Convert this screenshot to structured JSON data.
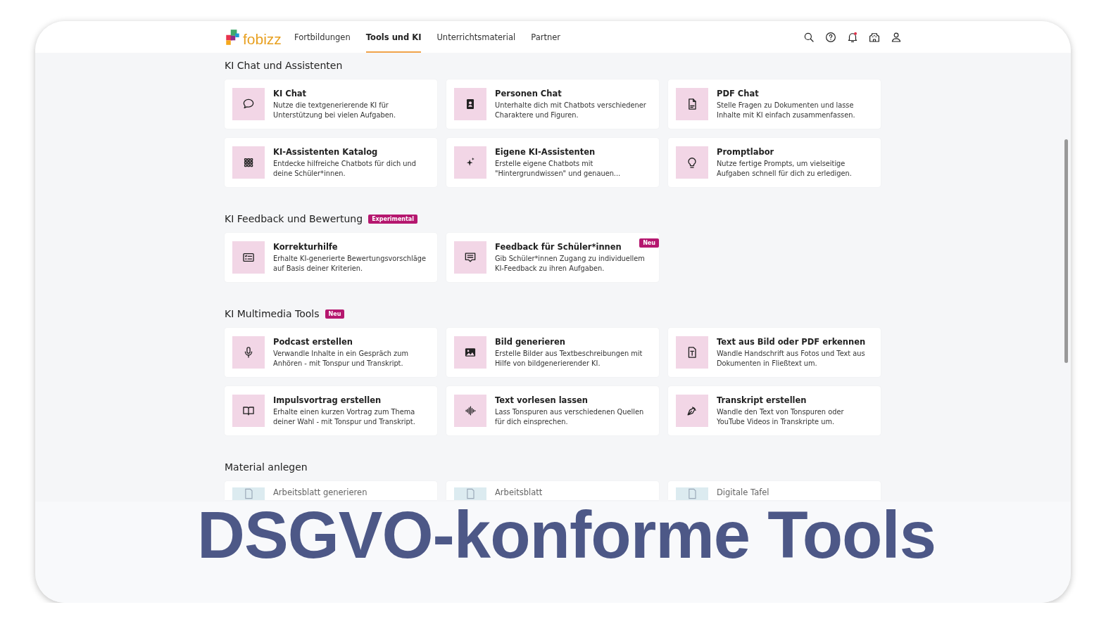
{
  "nav": {
    "logo": "fobizz",
    "items": [
      {
        "label": "Fortbildungen",
        "selected": false
      },
      {
        "label": "Tools und KI",
        "selected": true
      },
      {
        "label": "Unterrichtsmaterial",
        "selected": false
      },
      {
        "label": "Partner",
        "selected": false
      }
    ],
    "notifications_unread": true
  },
  "sections": [
    {
      "title": "KI Chat und Assistenten",
      "cards": [
        {
          "kind": "chat",
          "title": "KI Chat",
          "description": "Nutze die textgenerierende KI für Unterstützung bei vielen Aufgaben."
        },
        {
          "kind": "person",
          "title": "Personen Chat",
          "description": "Unterhalte dich mit Chatbots verschiedener Charaktere und Figuren."
        },
        {
          "kind": "pdf",
          "title": "PDF Chat",
          "description": "Stelle Fragen zu Dokumenten und lasse Inhalte mit KI einfach zusammenfassen."
        },
        {
          "kind": "grid",
          "title": "KI-Assistenten Katalog",
          "description": "Entdecke hilfreiche Chatbots für dich und deine Schüler*innen."
        },
        {
          "kind": "sparkle",
          "title": "Eigene KI-Assistenten",
          "description": "Erstelle eigene Chatbots mit \"Hintergrundwissen\" und genauen..."
        },
        {
          "kind": "bulb",
          "title": "Promptlabor",
          "description": "Nutze fertige Prompts, um vielseitige Aufgaben schnell für dich zu erledigen."
        }
      ]
    },
    {
      "title": "KI Feedback und Bewertung",
      "badge": "Experimental",
      "cards": [
        {
          "kind": "list",
          "title": "Korrekturhilfe",
          "description": "Erhalte KI-generierte Bewertungsvorschläge auf Basis deiner Kriterien."
        },
        {
          "kind": "message",
          "title": "Feedback für Schüler*innen",
          "description": "Gib Schüler*innen Zugang zu individuellem KI-Feedback zu ihren Aufgaben.",
          "badge": "Neu"
        }
      ]
    },
    {
      "title": "KI Multimedia Tools",
      "badge": "Neu",
      "cards": [
        {
          "kind": "mic",
          "title": "Podcast erstellen",
          "description": "Verwandle Inhalte in ein Gespräch zum Anhören - mit Tonspur und Transkript."
        },
        {
          "kind": "image",
          "title": "Bild generieren",
          "description": "Erstelle Bilder aus Textbeschreibungen mit Hilfe von bildgenerierender KI."
        },
        {
          "kind": "textfile",
          "title": "Text aus Bild oder PDF erkennen",
          "description": "Wandle Handschrift aus Fotos und Text aus Dokumenten in Fließtext um."
        },
        {
          "kind": "book",
          "title": "Impulsvortrag erstellen",
          "description": "Erhalte einen kurzen Vortrag zum Thema deiner Wahl - mit Tonspur und Transkript."
        },
        {
          "kind": "wave",
          "title": "Text vorlesen lassen",
          "description": "Lass Tonspuren aus verschiedenen Quellen für dich einsprechen."
        },
        {
          "kind": "pen",
          "title": "Transkript erstellen",
          "description": "Wandle den Text von Tonspuren oder YouTube Videos in Transkripte um."
        }
      ]
    },
    {
      "title": "Material anlegen",
      "cards": [
        {
          "kind": "sheet",
          "title": "Arbeitsblatt generieren"
        },
        {
          "kind": "sheet",
          "title": "Arbeitsblatt"
        },
        {
          "kind": "sheet",
          "title": "Digitale Tafel"
        }
      ]
    }
  ],
  "caption": "DSGVO-konforme Tools"
}
